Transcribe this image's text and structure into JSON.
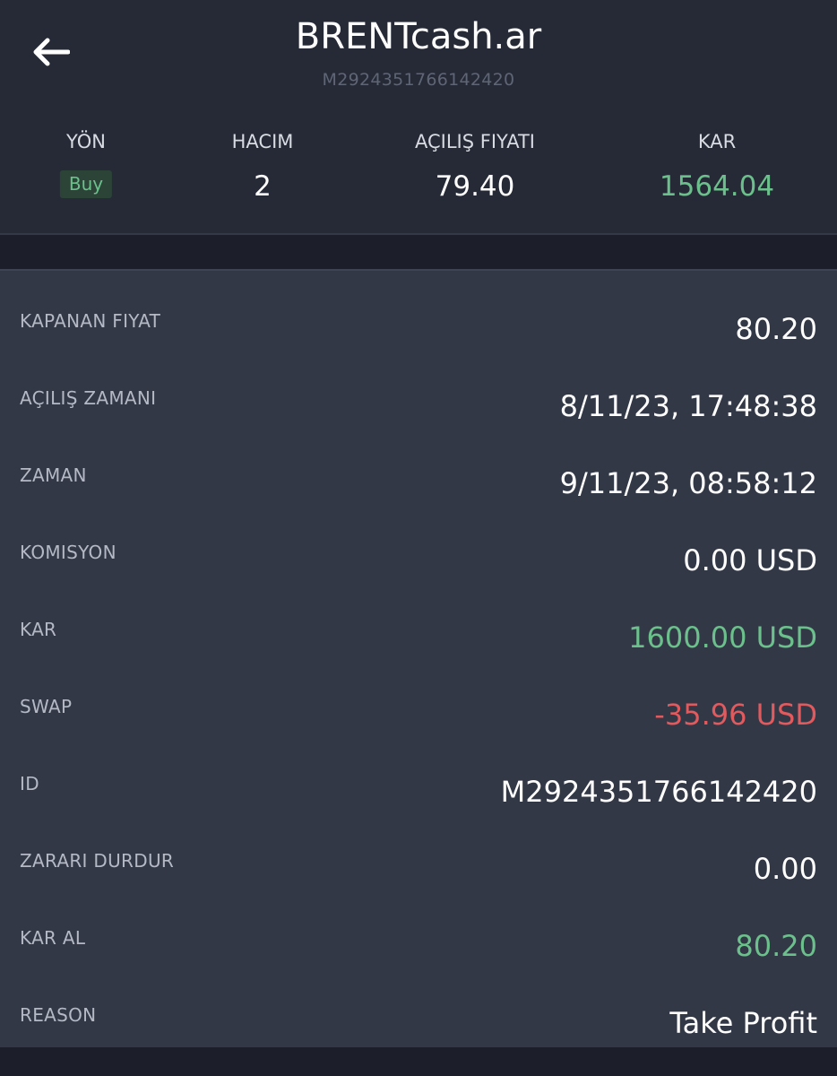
{
  "header": {
    "title": "BRENTcash.ar",
    "subtitle": "M2924351766142420"
  },
  "summary": {
    "direction": {
      "label": "YÖN",
      "value": "Buy"
    },
    "volume": {
      "label": "HACIM",
      "value": "2"
    },
    "open_price": {
      "label": "AÇILIŞ FIYATI",
      "value": "79.40"
    },
    "profit": {
      "label": "KAR",
      "value": "1564.04"
    }
  },
  "details": {
    "rows": [
      {
        "label": "KAPANAN FIYAT",
        "value": "80.20"
      },
      {
        "label": "AÇILIŞ ZAMANI",
        "value": "8/11/23, 17:48:38"
      },
      {
        "label": "ZAMAN",
        "value": "9/11/23, 08:58:12"
      },
      {
        "label": "KOMISYON",
        "value": "0.00 USD"
      },
      {
        "label": "KAR",
        "value": "1600.00 USD"
      },
      {
        "label": "SWAP",
        "value": "-35.96 USD"
      },
      {
        "label": "ID",
        "value": "M2924351766142420"
      },
      {
        "label": "ZARARI DURDUR",
        "value": "0.00"
      },
      {
        "label": "KAR AL",
        "value": "80.20"
      },
      {
        "label": "REASON",
        "value": "Take Profit"
      }
    ]
  },
  "colors": {
    "background": "#1c1f2a",
    "header_bg": "#262a36",
    "panel_bg": "#333847",
    "positive": "#6cc08c",
    "negative": "#e05a5e",
    "label": "#b4b9c5"
  },
  "icons": {
    "back": "arrow-left-icon"
  }
}
